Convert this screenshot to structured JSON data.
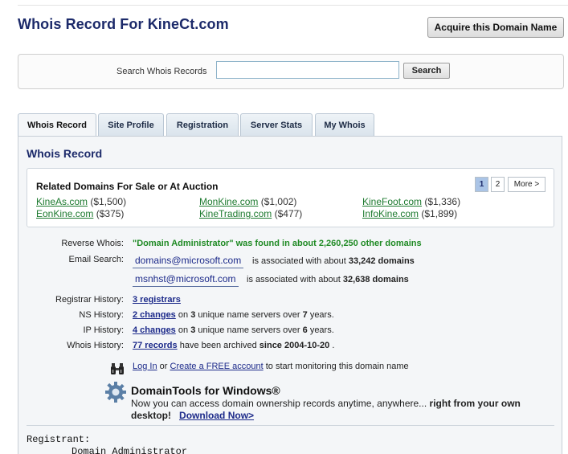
{
  "header": {
    "title": "Whois Record For KineCt.com",
    "acquire_label": "Acquire this Domain Name"
  },
  "search": {
    "label": "Search Whois Records",
    "value": "",
    "button_label": "Search"
  },
  "tabs": [
    {
      "label": "Whois Record",
      "active": true
    },
    {
      "label": "Site Profile",
      "active": false
    },
    {
      "label": "Registration",
      "active": false
    },
    {
      "label": "Server Stats",
      "active": false
    },
    {
      "label": "My Whois",
      "active": false
    }
  ],
  "panel": {
    "title": "Whois Record"
  },
  "related": {
    "title": "Related Domains For Sale or At Auction",
    "pager": {
      "page1": "1",
      "page2": "2",
      "more": "More >"
    },
    "items": [
      {
        "domain": "KineAs.com",
        "price": "($1,500)"
      },
      {
        "domain": "MonKine.com",
        "price": "($1,002)"
      },
      {
        "domain": "KineFoot.com",
        "price": "($1,336)"
      },
      {
        "domain": "EonKine.com",
        "price": "($375)"
      },
      {
        "domain": "KineTrading.com",
        "price": "($477)"
      },
      {
        "domain": "InfoKine.com",
        "price": "($1,899)"
      }
    ]
  },
  "details": {
    "reverse_whois": {
      "label": "Reverse Whois:",
      "text": "\"Domain Administrator\" was found in about 2,260,250 other domains"
    },
    "email_search": {
      "label": "Email Search:",
      "emails": [
        {
          "address": "domains@microsoft.com",
          "prefix": "is associated with about",
          "count": "33,242 domains"
        },
        {
          "address": "msnhst@microsoft.com",
          "prefix": "is associated with about",
          "count": "32,638 domains"
        }
      ]
    },
    "registrar_history": {
      "label": "Registrar History:",
      "link": "3 registrars"
    },
    "ns_history": {
      "label": "NS History:",
      "link": "2 changes",
      "mid": "on",
      "num": "3",
      "rest": "unique name servers over",
      "years": "7",
      "end": "years."
    },
    "ip_history": {
      "label": "IP History:",
      "link": "4 changes",
      "mid": "on",
      "num": "3",
      "rest": "unique name servers over",
      "years": "6",
      "end": "years."
    },
    "whois_history": {
      "label": "Whois History:",
      "link": "77 records",
      "rest": "have been archived",
      "since": "since 2004-10-20",
      "end": "."
    }
  },
  "monitor": {
    "login": "Log In",
    "or": "or",
    "create": "Create a FREE account",
    "rest": "to start monitoring this domain name"
  },
  "domaintools": {
    "title": "DomainTools for Windows®",
    "desc": "Now you can access domain ownership records anytime, anywhere...",
    "bold": "right from your own desktop!",
    "download": "Download Now>"
  },
  "registrant": {
    "label": "Registrant:",
    "name": "Domain Administrator"
  },
  "colors": {
    "title": "#1c2a6a",
    "green": "#1f8a24",
    "link": "#1c2a8a",
    "active_page": "#aac4e6"
  }
}
